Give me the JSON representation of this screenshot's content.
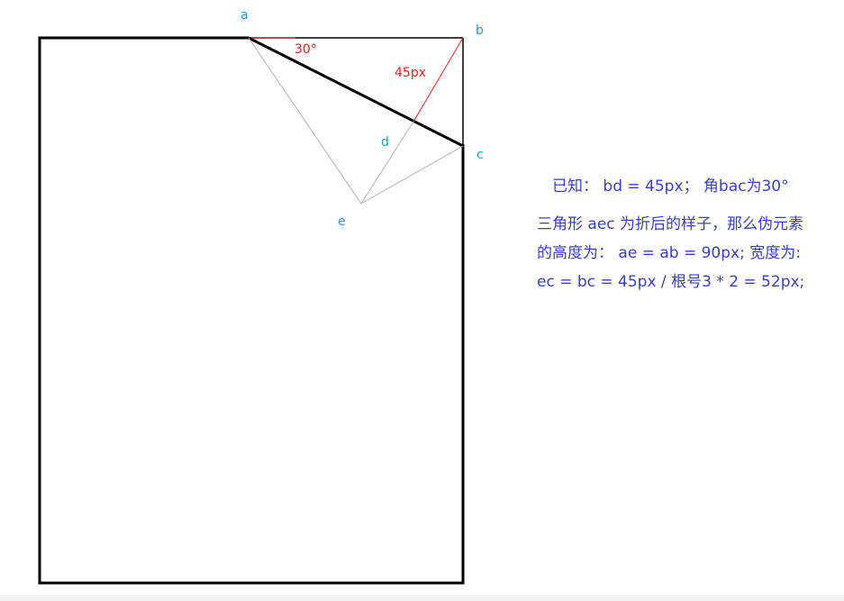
{
  "points": {
    "a": "a",
    "b": "b",
    "c": "c",
    "d": "d",
    "e": "e"
  },
  "annotations": {
    "angle": "30°",
    "length": "45px"
  },
  "notes": {
    "known": "已知： bd = 45px； 角bac为30°",
    "line1": "三角形 aec 为折后的样子，那么伪元素",
    "line2": "的高度为： ae = ab = 90px; 宽度为:",
    "line3": "ec = bc = 45px / 根号3 * 2 = 52px;"
  },
  "colors": {
    "point_label": "#1a9fd5",
    "red": "#e02020",
    "note_text": "#3a3fc0",
    "outline": "#000000",
    "fold_line": "#b0b0b0"
  }
}
